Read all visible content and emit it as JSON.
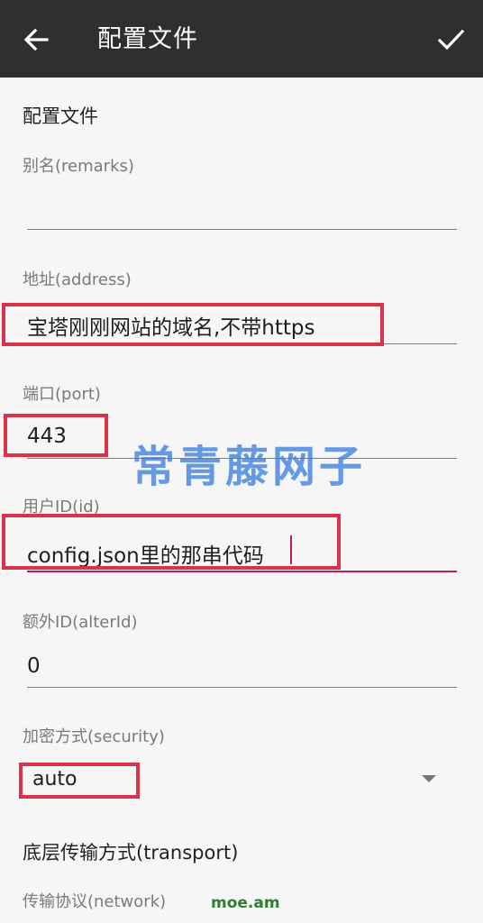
{
  "toolbar": {
    "title": "配置文件",
    "back_icon": "arrow-left-icon",
    "confirm_icon": "check-icon"
  },
  "section": {
    "title": "配置文件"
  },
  "fields": {
    "remarks": {
      "label": "别名(remarks)",
      "value": ""
    },
    "address": {
      "label": "地址(address)",
      "value": "宝塔刚刚网站的域名,不带https"
    },
    "port": {
      "label": "端口(port)",
      "value": "443"
    },
    "id": {
      "label": "用户ID(id)",
      "value": "config.json里的那串代码"
    },
    "alter_id": {
      "label": "额外ID(alterId)",
      "value": "0"
    },
    "security": {
      "label": "加密方式(security)",
      "value": "auto"
    }
  },
  "transport": {
    "title": "底层传输方式(transport)",
    "network_label": "传输协议(network)"
  },
  "watermarks": {
    "center": "常青藤网子",
    "footer": "moe.am"
  },
  "colors": {
    "toolbar_bg": "#2f2f2f",
    "background": "#f6f6f6",
    "accent": "#c2185b",
    "highlight_box": "#d8334a"
  }
}
